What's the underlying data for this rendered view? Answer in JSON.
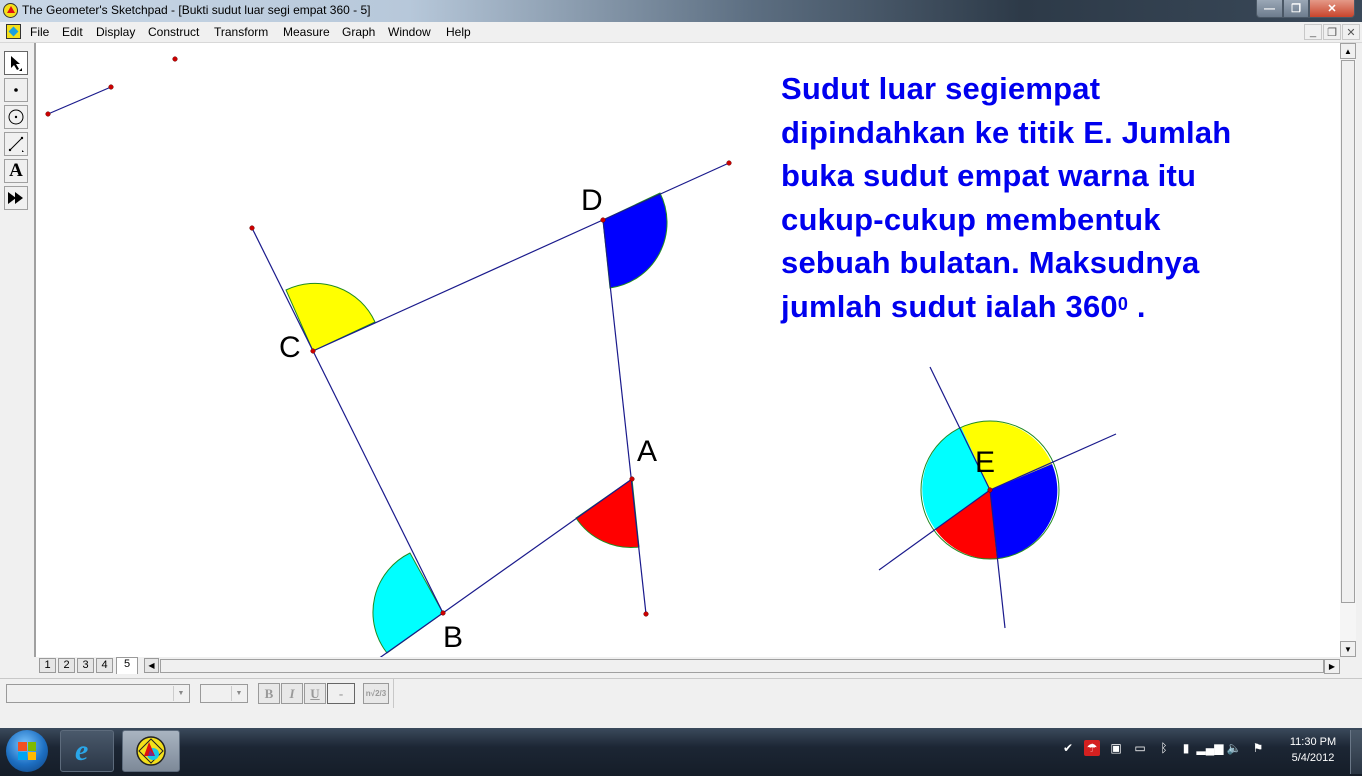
{
  "window": {
    "title": "The Geometer's Sketchpad - [Bukti sudut luar segi empat 360 - 5]",
    "controls": {
      "minimize": "minimize-icon",
      "maximize": "restore-icon",
      "close": "close-icon"
    }
  },
  "menubar": {
    "items": [
      "File",
      "Edit",
      "Display",
      "Construct",
      "Transform",
      "Measure",
      "Graph",
      "Window",
      "Help"
    ]
  },
  "toolbox": {
    "tools": [
      {
        "name": "selection-arrow-tool",
        "icon": "arrow-icon",
        "selected": true
      },
      {
        "name": "point-tool",
        "icon": "point-icon",
        "selected": false
      },
      {
        "name": "compass-tool",
        "icon": "circle-icon",
        "selected": false
      },
      {
        "name": "straightedge-tool",
        "icon": "segment-icon",
        "selected": false
      },
      {
        "name": "text-tool",
        "icon": "text-a-icon",
        "label": "A",
        "selected": false
      },
      {
        "name": "custom-tool",
        "icon": "fast-forward-icon",
        "selected": false
      }
    ]
  },
  "sketch": {
    "note_lines": [
      "Sudut luar segiempat",
      "dipindahkan ke titik E. Jumlah",
      "buka sudut empat warna itu",
      "cukup-cukup membentuk",
      "sebuah bulatan. Maksudnya"
    ],
    "note_last_line": "jumlah sudut ialah 360",
    "note_superscript": "0",
    "note_end": " .",
    "note_color": "#0000ee",
    "points": {
      "A": "A",
      "B": "B",
      "C": "C",
      "D": "D",
      "E": "E"
    },
    "angle_colors": {
      "A": "#ff0000",
      "B": "#00ffff",
      "C": "#ffff00",
      "D": "#0000ff"
    },
    "line_color": "#1a1a8c",
    "point_color": "#cc0000",
    "arc_outline_color": "#228b22"
  },
  "page_tabs": {
    "tabs": [
      "1",
      "2",
      "3",
      "4",
      "5"
    ],
    "active": "5"
  },
  "text_toolbar": {
    "font_value": "",
    "size_value": "",
    "bold": "B",
    "italic": "I",
    "underline": "U",
    "color": "-",
    "math_format": "n√2/3"
  },
  "taskbar": {
    "apps": [
      "start-button",
      "internet-explorer",
      "geometers-sketchpad"
    ],
    "tray": [
      "network-check-icon",
      "antivirus-icon",
      "display-icon",
      "touchpad-icon",
      "bluetooth-icon",
      "power-icon",
      "signal-icon",
      "volume-icon",
      "action-center-flag-icon"
    ],
    "time": "11:30 PM",
    "date": "5/4/2012"
  }
}
